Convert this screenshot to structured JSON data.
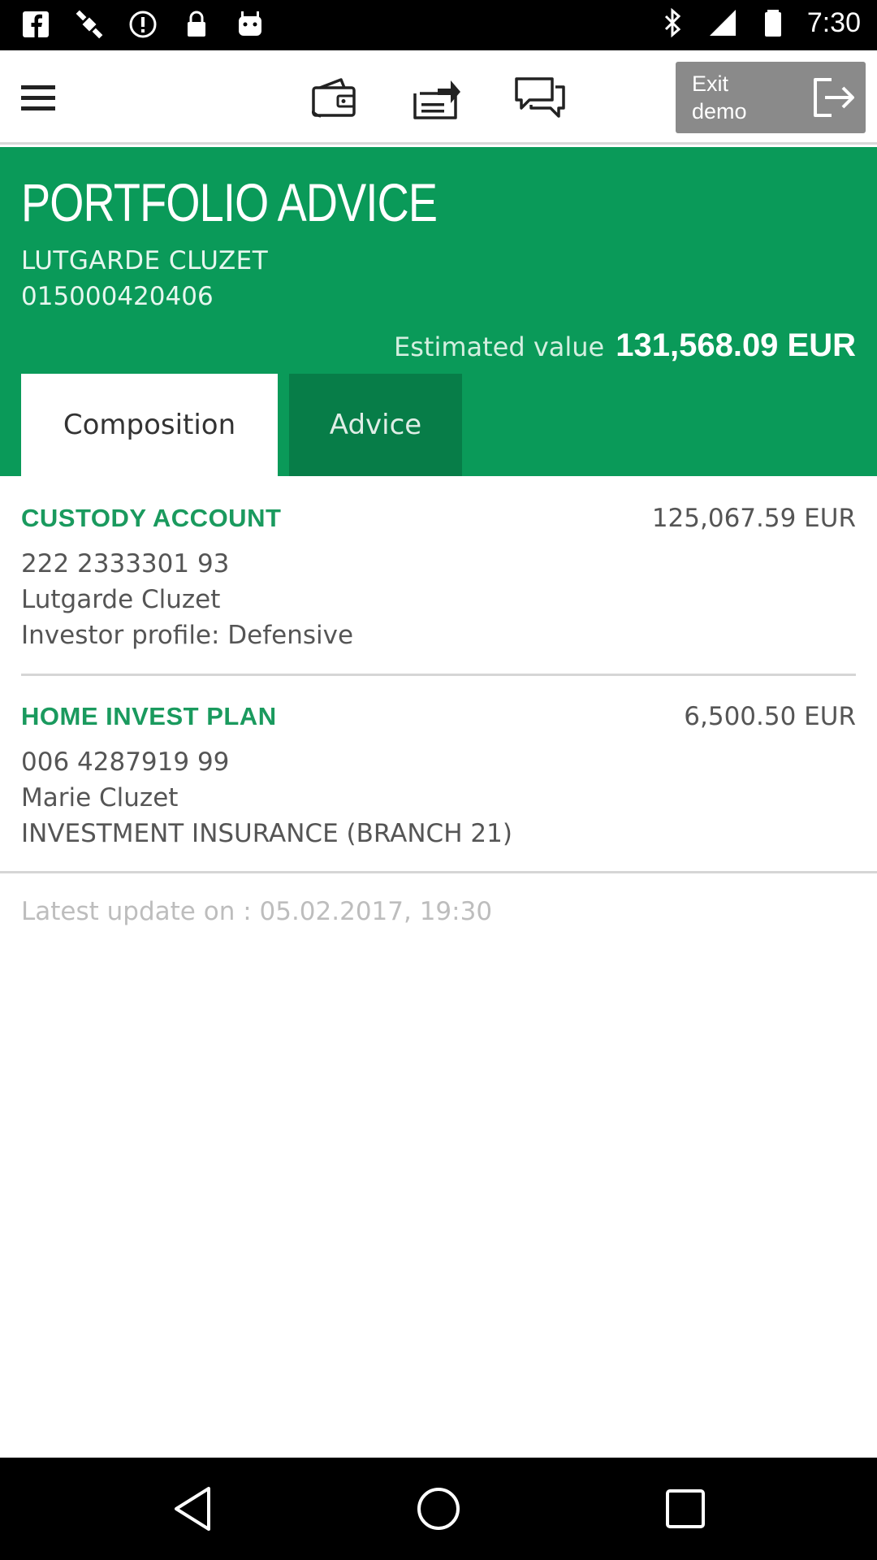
{
  "status_bar": {
    "time": "7:30",
    "icons": [
      "facebook-icon",
      "fake-gps-icon",
      "alert-icon",
      "lock-icon",
      "android-icon",
      "bluetooth-icon",
      "signal-icon",
      "battery-icon"
    ]
  },
  "toolbar": {
    "icons": [
      "menu-icon",
      "wallet-icon",
      "transfer-icon",
      "chat-icon"
    ],
    "exit_label": "Exit demo",
    "exit_icon": "exit-icon"
  },
  "header": {
    "title": "PORTFOLIO ADVICE",
    "client_name": "LUTGARDE CLUZET",
    "client_number": "015000420406",
    "estimated_label": "Estimated value",
    "estimated_value": "131,568.09 EUR"
  },
  "tabs": [
    {
      "label": "Composition",
      "active": true
    },
    {
      "label": "Advice",
      "active": false
    }
  ],
  "accounts": [
    {
      "title": "CUSTODY ACCOUNT",
      "amount": "125,067.59 EUR",
      "number": "222 2333301 93",
      "holder": "Lutgarde Cluzet",
      "detail": "Investor profile: Defensive"
    },
    {
      "title": "HOME INVEST PLAN",
      "amount": "6,500.50 EUR",
      "number": "006 4287919 99",
      "holder": "Marie Cluzet",
      "detail": "INVESTMENT INSURANCE (BRANCH 21)"
    }
  ],
  "last_update": "Latest update on : 05.02.2017, 19:30",
  "colors": {
    "brand_green": "#0a9a59",
    "tab_dark_green": "#077d48",
    "account_title_green": "#1a9a5e",
    "exit_button_gray": "#8a8a8a"
  },
  "nav_bar": {
    "icons": [
      "back-icon",
      "home-icon",
      "recent-apps-icon"
    ]
  }
}
